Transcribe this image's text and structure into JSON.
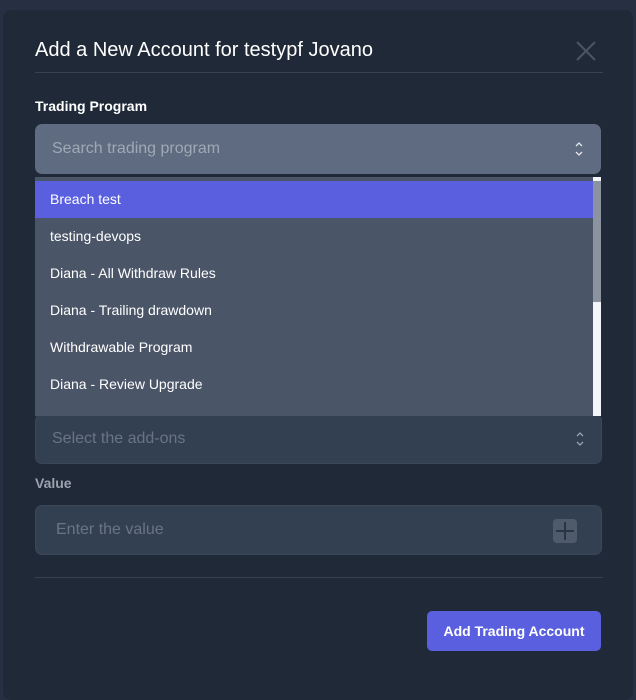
{
  "modal": {
    "title": "Add a New Account for testypf Jovano"
  },
  "trading_program": {
    "label": "Trading Program",
    "placeholder": "Search trading program",
    "options": [
      "Breach test",
      "testing-devops",
      "Diana - All Withdraw Rules",
      "Diana - Trailing drawdown",
      "Withdrawable Program",
      "Diana - Review Upgrade"
    ],
    "selected_index": 0
  },
  "addons": {
    "placeholder": "Select the add-ons"
  },
  "value": {
    "label": "Value",
    "placeholder": "Enter the value"
  },
  "submit_label": "Add Trading Account",
  "colors": {
    "accent": "#5a5fe0",
    "modal_bg": "#1f2937"
  }
}
